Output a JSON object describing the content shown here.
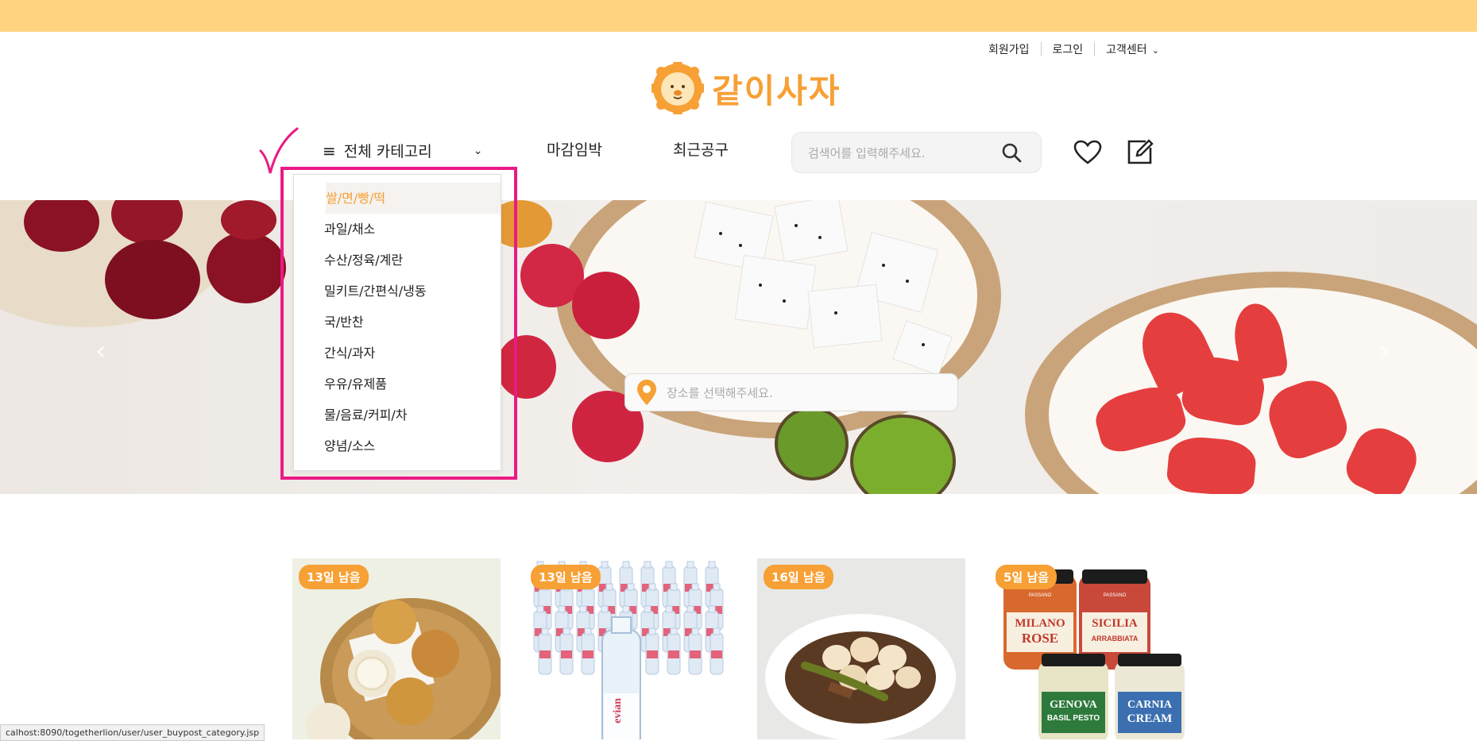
{
  "header": {
    "signup": "회원가입",
    "login": "로그인",
    "support": "고객센터",
    "logo_text": "같이사자"
  },
  "nav": {
    "all_categories": "전체 카테고리",
    "deadline": "마감임박",
    "recent": "최근공구",
    "search_placeholder": "검색어를 입력해주세요."
  },
  "categories": [
    "쌀/면/빵/떡",
    "과일/채소",
    "수산/정육/계란",
    "밀키트/간편식/냉동",
    "국/반찬",
    "간식/과자",
    "우유/유제품",
    "물/음료/커피/차",
    "양념/소스"
  ],
  "banner": {
    "place_placeholder": "장소를 선택해주세요."
  },
  "products": [
    {
      "badge": "13일 남음"
    },
    {
      "badge": "13일 남음"
    },
    {
      "badge": "16일 남음"
    },
    {
      "badge": "5일 남음"
    }
  ],
  "jars": {
    "j1_small": "PASSANO",
    "j1_big": "MILANO",
    "j1_sub": "ROSE",
    "j2_small": "PASSANO",
    "j2_big": "SICILIA",
    "j2_sub": "ARRABBIATA",
    "j3_big": "GENOVA",
    "j3_sub": "BASIL PESTO",
    "j4_big": "CARNIA",
    "j4_sub": "CREAM"
  },
  "bottle_brand": "evian",
  "status_url": "calhost:8090/togetherlion/user/user_buypost_category.jsp",
  "colors": {
    "top_bar": "#ffd37f",
    "brand": "#f7a035",
    "highlight": "#ea1a84"
  }
}
